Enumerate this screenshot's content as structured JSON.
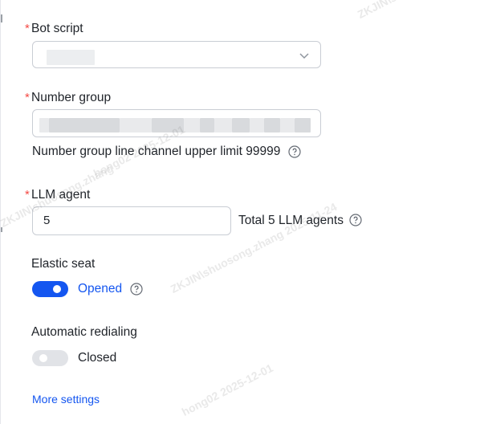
{
  "bot_script": {
    "label": "Bot script",
    "required_mark": "*",
    "icon": "chevron-down-icon"
  },
  "number_group": {
    "label": "Number group",
    "required_mark": "*",
    "hint": "Number group line channel upper limit 99999",
    "hint_icon": "question-circle-icon"
  },
  "llm_agent": {
    "label": "LLM agent",
    "required_mark": "*",
    "value": "5",
    "total_text": "Total 5 LLM agents",
    "total_icon": "question-circle-icon"
  },
  "elastic_seat": {
    "label": "Elastic seat",
    "enabled": true,
    "state_text": "Opened",
    "state_icon": "question-circle-icon"
  },
  "automatic_redialing": {
    "label": "Automatic redialing",
    "enabled": false,
    "state_text": "Closed"
  },
  "more_settings": {
    "label": "More settings"
  },
  "watermarks": [
    "ZKJIN\\shuosong.zhang",
    "ZKJIN\\shuosong.zhang 2025-11-24",
    "ZKJIN\\shuo",
    "hong02  2025-12-01",
    "hong02  2025-12-01"
  ],
  "colors": {
    "accent": "#1456f0",
    "required": "#f54a45",
    "toggle_off": "#e1e3e7",
    "border": "#c9cdd4"
  }
}
